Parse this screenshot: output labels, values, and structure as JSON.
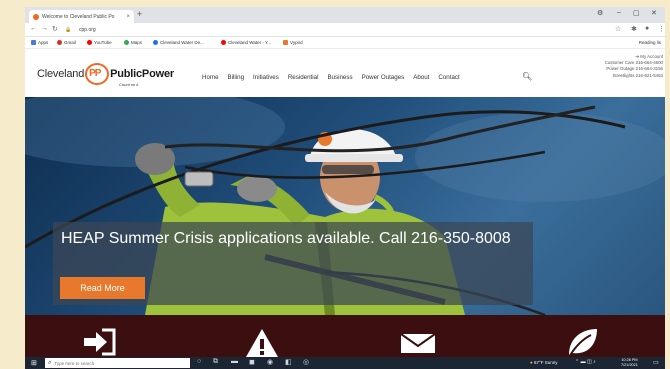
{
  "browser": {
    "tab_title": "Welcome to Cleveland Public Po",
    "tab_close": "×",
    "new_tab": "+",
    "window_controls": [
      "⚙",
      "–",
      "▢",
      "✕"
    ],
    "url": "cpp.org",
    "bookmarks": [
      {
        "label": "Apps",
        "color": "#4a7bd0"
      },
      {
        "label": "Gmail",
        "color": "#d93025"
      },
      {
        "label": "YouTube",
        "color": "#ff0000"
      },
      {
        "label": "Maps",
        "color": "#34a853"
      },
      {
        "label": "Cleveland Water De...",
        "color": "#1a73e8"
      },
      {
        "label": "Cleveland Water - Y...",
        "color": "#ff0000"
      },
      {
        "label": "Vypird",
        "color": "#e8782b"
      }
    ],
    "reading_list": "Reading lis"
  },
  "site": {
    "logo": {
      "cleveland": "Cleveland",
      "pp": "PP",
      "public_power": "PublicPower",
      "tagline": "Count on it"
    },
    "nav": [
      "Home",
      "Billing",
      "Initiatives",
      "Residential",
      "Business",
      "Power Outages",
      "About",
      "Contact"
    ],
    "contact": {
      "my_account": "My Account",
      "customer_care": "Customer Care 216-664-4600",
      "power_outage": "Power Outage 216-664-3156",
      "streetlights": "Streetlights 216-621-5463"
    },
    "hero": {
      "headline": "HEAP Summer Crisis applications available. Call 216-350-8008",
      "cta": "Read More"
    },
    "quicklink_icons": [
      "sign-in-icon",
      "warning-icon",
      "envelope-icon",
      "leaf-icon"
    ]
  },
  "taskbar": {
    "search_placeholder": "Type here to search",
    "weather": "67°F Sunny",
    "time": "10:26 PM",
    "date": "7/21/2021"
  },
  "colors": {
    "accent": "#f26722",
    "banner_button": "#e8782b",
    "quicklinks_bg": "#3b0f0f"
  }
}
